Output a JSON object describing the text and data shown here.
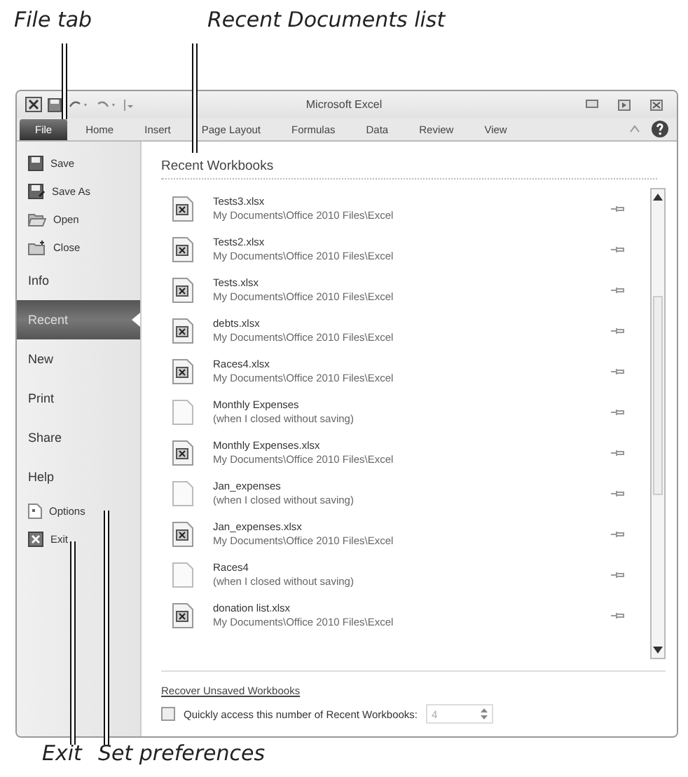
{
  "callouts_top": [
    {
      "label": "File tab"
    },
    {
      "label": "Recent Documents list"
    }
  ],
  "window": {
    "title": "Microsoft Excel"
  },
  "tabs": [
    {
      "label": "File",
      "selected": true
    },
    {
      "label": "Home",
      "selected": false
    },
    {
      "label": "Insert",
      "selected": false
    },
    {
      "label": "Page Layout",
      "selected": false
    },
    {
      "label": "Formulas",
      "selected": false
    },
    {
      "label": "Data",
      "selected": false
    },
    {
      "label": "Review",
      "selected": false
    },
    {
      "label": "View",
      "selected": false
    }
  ],
  "sidebar": {
    "items": [
      {
        "label": "Save",
        "kind": "command",
        "selected": false
      },
      {
        "label": "Save As",
        "kind": "command",
        "selected": false
      },
      {
        "label": "Open",
        "kind": "command",
        "selected": false
      },
      {
        "label": "Close",
        "kind": "command",
        "selected": false
      },
      {
        "label": "Info",
        "kind": "page",
        "selected": false
      },
      {
        "label": "Recent",
        "kind": "page",
        "selected": true
      },
      {
        "label": "New",
        "kind": "page",
        "selected": false
      },
      {
        "label": "Print",
        "kind": "page",
        "selected": false
      },
      {
        "label": "Share",
        "kind": "page",
        "selected": false
      },
      {
        "label": "Help",
        "kind": "page",
        "selected": false
      },
      {
        "label": "Options",
        "kind": "command",
        "selected": false
      },
      {
        "label": "Exit",
        "kind": "command",
        "selected": false
      }
    ]
  },
  "recent": {
    "heading": "Recent Workbooks",
    "documents": [
      {
        "name": "Tests3.xlsx",
        "path": "My Documents\\Office 2010 Files\\Excel",
        "kind": "workbook"
      },
      {
        "name": "Tests2.xlsx",
        "path": "My Documents\\Office 2010 Files\\Excel",
        "kind": "workbook"
      },
      {
        "name": "Tests.xlsx",
        "path": "My Documents\\Office 2010 Files\\Excel",
        "kind": "workbook"
      },
      {
        "name": "debts.xlsx",
        "path": "My Documents\\Office 2010 Files\\Excel",
        "kind": "workbook"
      },
      {
        "name": "Races4.xlsx",
        "path": "My Documents\\Office 2010 Files\\Excel",
        "kind": "workbook"
      },
      {
        "name": "Monthly Expenses",
        "path": "(when I closed without saving)",
        "kind": "unsaved"
      },
      {
        "name": "Monthly Expenses.xlsx",
        "path": "My Documents\\Office 2010 Files\\Excel",
        "kind": "workbook"
      },
      {
        "name": "Jan_expenses",
        "path": "(when I closed without saving)",
        "kind": "unsaved"
      },
      {
        "name": "Jan_expenses.xlsx",
        "path": "My Documents\\Office 2010 Files\\Excel",
        "kind": "workbook"
      },
      {
        "name": "Races4",
        "path": "(when I closed without saving)",
        "kind": "unsaved"
      },
      {
        "name": "donation list.xlsx",
        "path": "My Documents\\Office 2010 Files\\Excel",
        "kind": "workbook"
      }
    ],
    "recover_link": "Recover Unsaved Workbooks",
    "quick_access": {
      "label": "Quickly access this number of Recent Workbooks:",
      "checked": false,
      "value": "4"
    }
  },
  "callouts_bottom": [
    {
      "label": "Exit"
    },
    {
      "label": "Set preferences"
    }
  ]
}
